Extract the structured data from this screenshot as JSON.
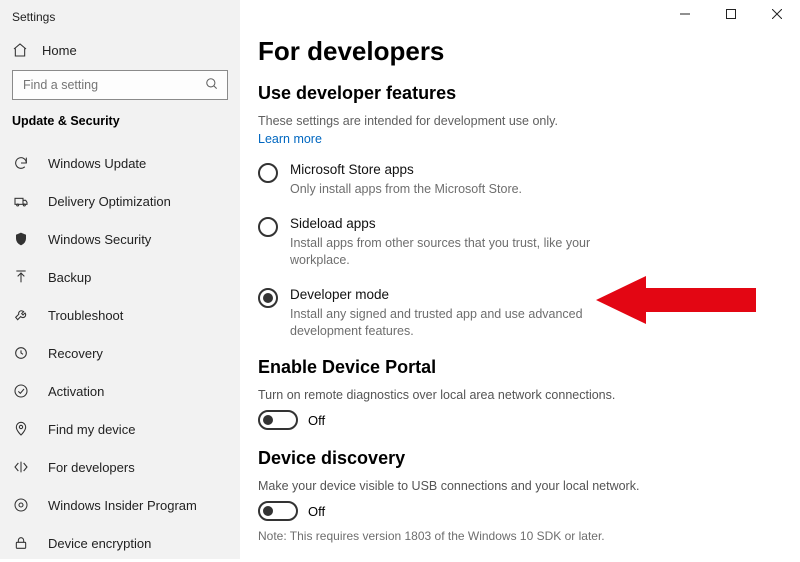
{
  "window": {
    "app_title": "Settings"
  },
  "sidebar": {
    "home_label": "Home",
    "search_placeholder": "Find a setting",
    "section_heading": "Update & Security",
    "items": [
      {
        "label": "Windows Update"
      },
      {
        "label": "Delivery Optimization"
      },
      {
        "label": "Windows Security"
      },
      {
        "label": "Backup"
      },
      {
        "label": "Troubleshoot"
      },
      {
        "label": "Recovery"
      },
      {
        "label": "Activation"
      },
      {
        "label": "Find my device"
      },
      {
        "label": "For developers"
      },
      {
        "label": "Windows Insider Program"
      },
      {
        "label": "Device encryption"
      }
    ]
  },
  "page": {
    "title": "For developers",
    "dev_features": {
      "heading": "Use developer features",
      "intro": "These settings are intended for development use only.",
      "learn_more": "Learn more",
      "options": [
        {
          "label": "Microsoft Store apps",
          "desc": "Only install apps from the Microsoft Store.",
          "selected": false
        },
        {
          "label": "Sideload apps",
          "desc": "Install apps from other sources that you trust, like your workplace.",
          "selected": false
        },
        {
          "label": "Developer mode",
          "desc": "Install any signed and trusted app and use advanced development features.",
          "selected": true
        }
      ]
    },
    "device_portal": {
      "heading": "Enable Device Portal",
      "desc": "Turn on remote diagnostics over local area network connections.",
      "toggle_state": "Off"
    },
    "device_discovery": {
      "heading": "Device discovery",
      "desc": "Make your device visible to USB connections and your local network.",
      "toggle_state": "Off",
      "note": "Note: This requires version 1803 of the Windows 10 SDK or later."
    }
  }
}
